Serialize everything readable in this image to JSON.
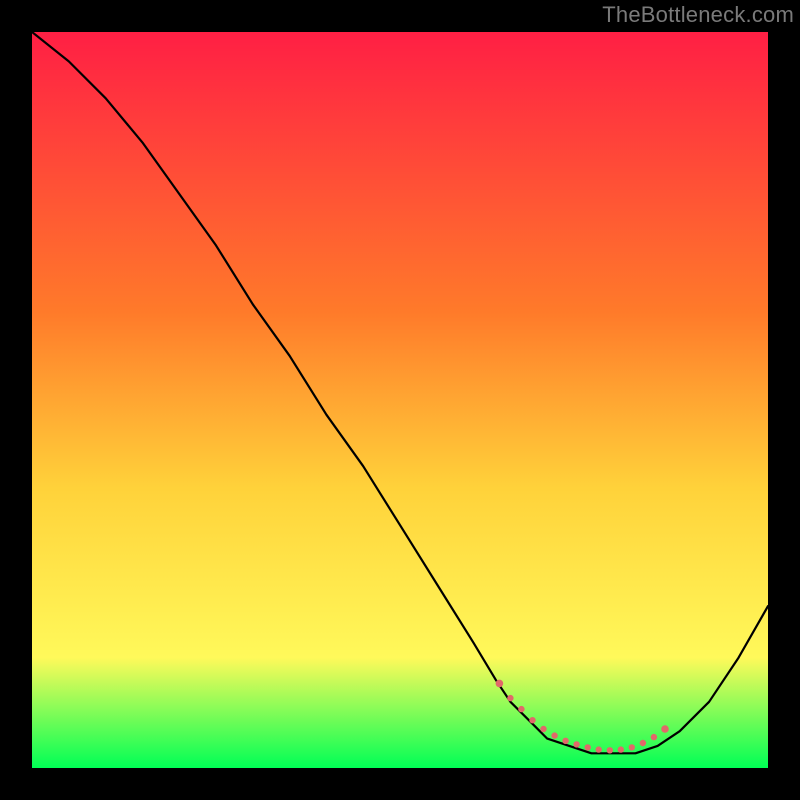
{
  "watermark": "TheBottleneck.com",
  "colors": {
    "frame": "#000000",
    "watermark_text": "#7a7a7a",
    "gradient_top": "#ff1f44",
    "gradient_mid1": "#ff7a2a",
    "gradient_mid2": "#ffd23a",
    "gradient_mid3": "#fff95a",
    "gradient_bottom": "#00ff55",
    "line": "#000000",
    "marker": "#e16969"
  },
  "chart_data": {
    "type": "line",
    "title": "",
    "xlabel": "",
    "ylabel": "",
    "xlim": [
      0,
      100
    ],
    "ylim": [
      0,
      100
    ],
    "grid": false,
    "legend_position": "none",
    "series": [
      {
        "name": "curve",
        "x": [
          0,
          5,
          10,
          15,
          20,
          25,
          30,
          35,
          40,
          45,
          50,
          55,
          60,
          63,
          65,
          68,
          70,
          73,
          76,
          79,
          82,
          85,
          88,
          92,
          96,
          100
        ],
        "y": [
          100,
          96,
          91,
          85,
          78,
          71,
          63,
          56,
          48,
          41,
          33,
          25,
          17,
          12,
          9,
          6,
          4,
          3,
          2,
          2,
          2,
          3,
          5,
          9,
          15,
          22
        ]
      }
    ],
    "markers": {
      "name": "highlight",
      "x": [
        63.5,
        65,
        66.5,
        68,
        69.5,
        71,
        72.5,
        74,
        75.5,
        77,
        78.5,
        80,
        81.5,
        83,
        84.5,
        86
      ],
      "y": [
        11.5,
        9.5,
        8.0,
        6.5,
        5.3,
        4.4,
        3.7,
        3.2,
        2.8,
        2.5,
        2.4,
        2.5,
        2.8,
        3.4,
        4.2,
        5.3
      ]
    }
  }
}
